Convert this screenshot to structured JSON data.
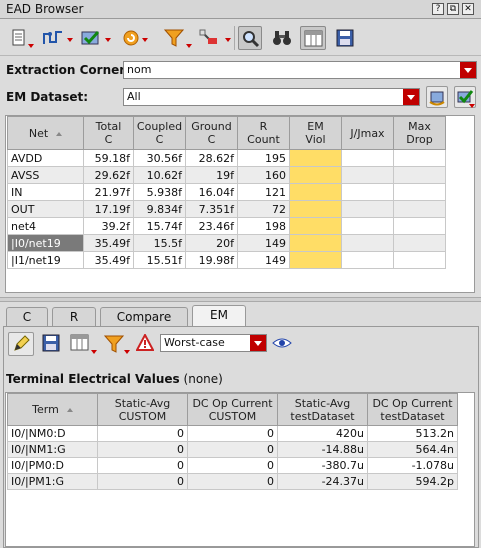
{
  "window": {
    "title": "EAD Browser",
    "buttons": [
      "?",
      "⧉",
      "✕"
    ]
  },
  "toolbar": {
    "icons": [
      "document-icon",
      "parasitic-network-icon",
      "check-dataset-icon",
      "refresh-icon",
      "filter-icon",
      "probe-icon",
      "find-icon",
      "binoculars-icon",
      "table-view-icon",
      "save-icon"
    ]
  },
  "extraction_corner": {
    "label": "Extraction Corner:",
    "value": "nom"
  },
  "em_dataset": {
    "label": "EM Dataset:",
    "value": "All"
  },
  "net_table": {
    "columns": [
      [
        "Net",
        ""
      ],
      [
        "Total",
        "C"
      ],
      [
        "Coupled",
        "C"
      ],
      [
        "Ground",
        "C"
      ],
      [
        "R",
        "Count"
      ],
      [
        "EM",
        "Viol"
      ],
      [
        "J/Jmax",
        ""
      ],
      [
        "Max",
        "Drop"
      ]
    ],
    "rows": [
      {
        "net": "AVDD",
        "total": "59.18f",
        "coupled": "30.56f",
        "ground": "28.62f",
        "rcount": "195"
      },
      {
        "net": "AVSS",
        "total": "29.62f",
        "coupled": "10.62f",
        "ground": "19f",
        "rcount": "160"
      },
      {
        "net": "IN",
        "total": "21.97f",
        "coupled": "5.938f",
        "ground": "16.04f",
        "rcount": "121"
      },
      {
        "net": "OUT",
        "total": "17.19f",
        "coupled": "9.834f",
        "ground": "7.351f",
        "rcount": "72"
      },
      {
        "net": "net4",
        "total": "39.2f",
        "coupled": "15.74f",
        "ground": "23.46f",
        "rcount": "198"
      },
      {
        "net": "|I0/net19",
        "total": "35.49f",
        "coupled": "15.5f",
        "ground": "20f",
        "rcount": "149"
      },
      {
        "net": "|I1/net19",
        "total": "35.49f",
        "coupled": "15.51f",
        "ground": "19.98f",
        "rcount": "149"
      }
    ],
    "em_color": "#ffdd66"
  },
  "tabs": [
    "C",
    "R",
    "Compare",
    "EM"
  ],
  "em_panel": {
    "mode": "Worst-case",
    "section_title": "Terminal Electrical Values",
    "section_note": "(none)",
    "columns": [
      [
        "Term",
        ""
      ],
      [
        "Static-Avg",
        "CUSTOM"
      ],
      [
        "DC Op Current",
        "CUSTOM"
      ],
      [
        "Static-Avg",
        "testDataset"
      ],
      [
        "DC Op Current",
        "testDataset"
      ]
    ],
    "rows": [
      {
        "term": "I0/|NM0:D",
        "sa_custom": "0",
        "dc_custom": "0",
        "sa_test": "420u",
        "dc_test": "513.2n"
      },
      {
        "term": "I0/|NM1:G",
        "sa_custom": "0",
        "dc_custom": "0",
        "sa_test": "-14.88u",
        "dc_test": "564.4n"
      },
      {
        "term": "I0/|PM0:D",
        "sa_custom": "0",
        "dc_custom": "0",
        "sa_test": "-380.7u",
        "dc_test": "-1.078u"
      },
      {
        "term": "I0/|PM1:G",
        "sa_custom": "0",
        "dc_custom": "0",
        "sa_test": "-24.37u",
        "dc_test": "594.2p"
      }
    ]
  }
}
